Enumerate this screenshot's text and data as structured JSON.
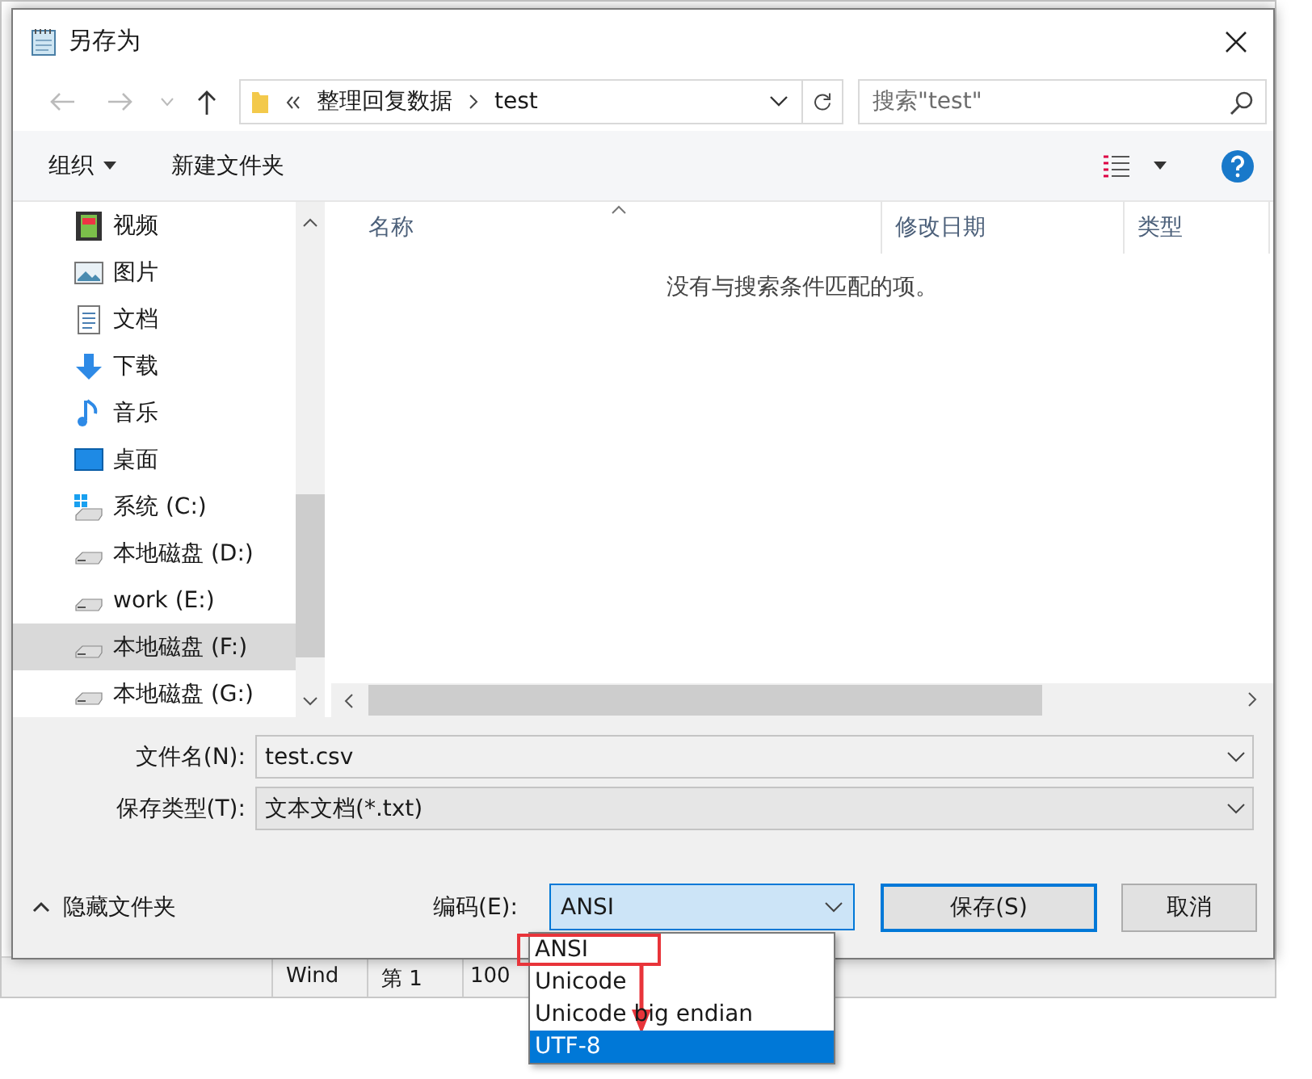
{
  "background": {
    "status_bar": [
      "Wind",
      "第 1",
      "100"
    ]
  },
  "window": {
    "title": "另存为"
  },
  "address": {
    "path": [
      "整理回复数据",
      "test"
    ]
  },
  "search": {
    "placeholder": "搜索\"test\""
  },
  "toolbar": {
    "organize": "组织",
    "new_folder": "新建文件夹"
  },
  "sidebar": {
    "items": [
      {
        "label": "视频",
        "kind": "video",
        "selected": false
      },
      {
        "label": "图片",
        "kind": "picture",
        "selected": false
      },
      {
        "label": "文档",
        "kind": "document",
        "selected": false
      },
      {
        "label": "下载",
        "kind": "download",
        "selected": false
      },
      {
        "label": "音乐",
        "kind": "music",
        "selected": false
      },
      {
        "label": "桌面",
        "kind": "desktop",
        "selected": false
      },
      {
        "label": "系统 (C:)",
        "kind": "system",
        "selected": false
      },
      {
        "label": "本地磁盘 (D:)",
        "kind": "drive",
        "selected": false
      },
      {
        "label": "work (E:)",
        "kind": "drive",
        "selected": false
      },
      {
        "label": "本地磁盘 (F:)",
        "kind": "drive",
        "selected": true
      },
      {
        "label": "本地磁盘 (G:)",
        "kind": "drive",
        "selected": false
      }
    ]
  },
  "table": {
    "columns": [
      "名称",
      "修改日期",
      "类型"
    ],
    "empty_message": "没有与搜索条件匹配的项。"
  },
  "fields": [
    {
      "label": "文件名(N):",
      "value": "test.csv",
      "kind": "edit"
    },
    {
      "label": "保存类型(T):",
      "value": "文本文档(*.txt)",
      "kind": "combo"
    }
  ],
  "hide_folders": "隐藏文件夹",
  "encoding": {
    "label": "编码(E):",
    "value": "ANSI",
    "options": [
      {
        "label": "ANSI",
        "highlighted": false
      },
      {
        "label": "Unicode",
        "highlighted": false
      },
      {
        "label": "Unicode big endian",
        "highlighted": false
      },
      {
        "label": "UTF-8",
        "highlighted": true
      }
    ]
  },
  "buttons": [
    {
      "label": "保存(S)",
      "kind": "primary"
    },
    {
      "label": "取消",
      "kind": "normal"
    }
  ]
}
